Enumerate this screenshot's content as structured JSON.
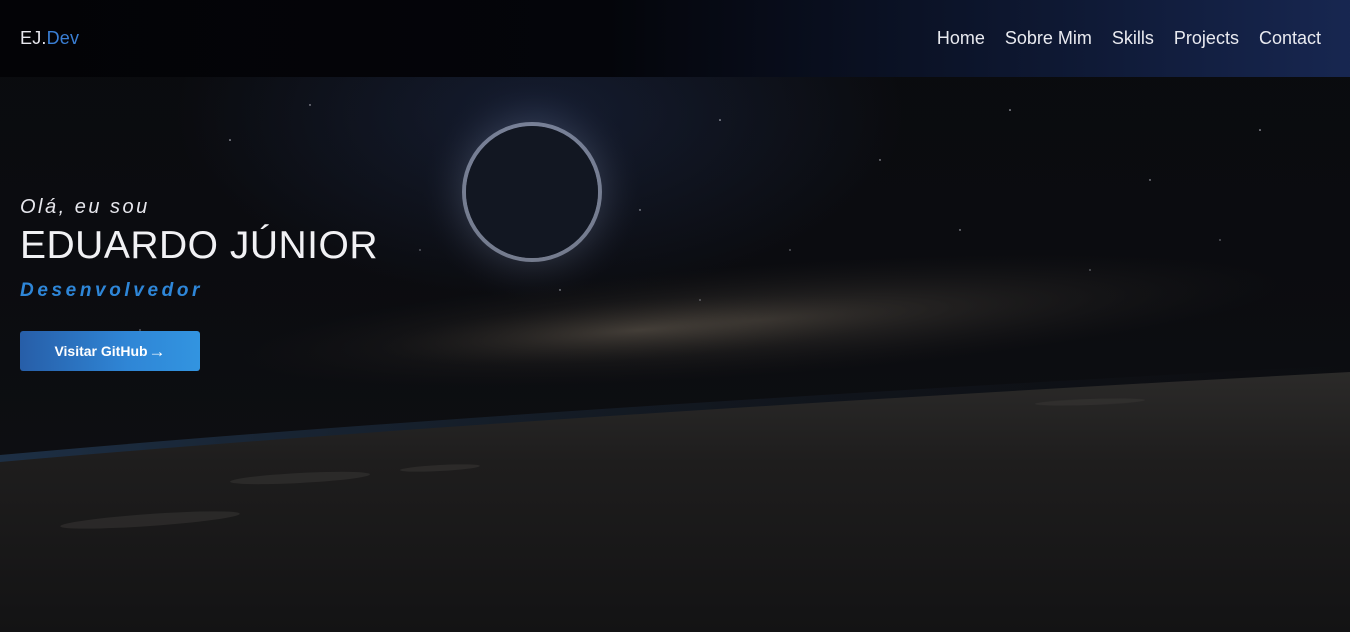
{
  "navbar": {
    "logo_main": "EJ.",
    "logo_accent": "Dev",
    "links": [
      "Home",
      "Sobre Mim",
      "Skills",
      "Projects",
      "Contact"
    ]
  },
  "hero": {
    "greeting": "Olá, eu sou",
    "name": "EDUARDO JÚNIOR",
    "role": "Desenvolvedor",
    "button_label": "Visitar GitHub",
    "button_icon": "arrow-right-icon"
  },
  "colors": {
    "accent": "#2e86d8",
    "navbar_end": "#182854",
    "background": "#0d0e11"
  }
}
